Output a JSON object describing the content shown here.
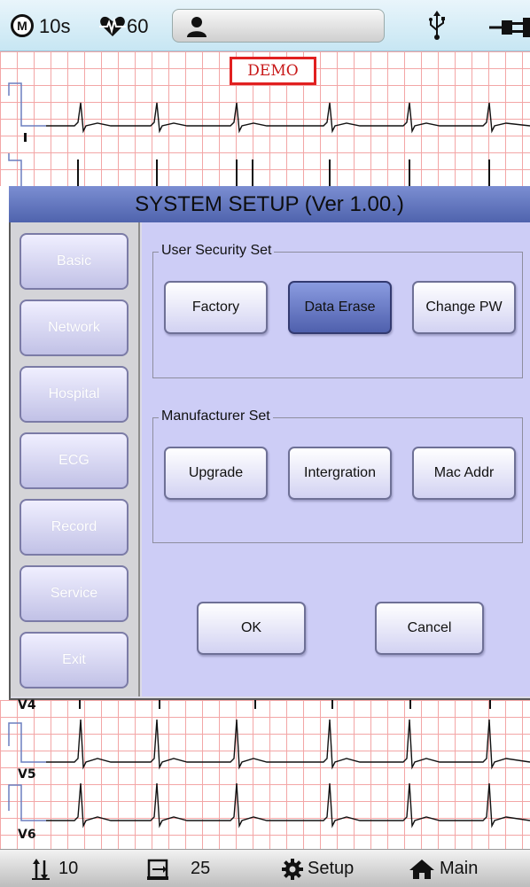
{
  "status": {
    "mode_letter": "M",
    "duration": "10s",
    "heart_rate": "60"
  },
  "demo_label": "DEMO",
  "leads_bottom": [
    "V4",
    "V5",
    "V6"
  ],
  "dialog": {
    "title": "SYSTEM SETUP (Ver 1.00.)",
    "sidebar": [
      "Basic",
      "Network",
      "Hospital",
      "ECG",
      "Record",
      "Service",
      "Exit"
    ],
    "user_security": {
      "title": "User Security Set",
      "buttons": [
        "Factory",
        "Data Erase",
        "Change PW"
      ],
      "selected": "Data Erase"
    },
    "manufacturer": {
      "title": "Manufacturer Set",
      "buttons": [
        "Upgrade",
        "Intergration",
        "Mac Addr"
      ]
    },
    "ok_label": "OK",
    "cancel_label": "Cancel"
  },
  "toolbar": {
    "speed": "10",
    "gain": "25",
    "setup_label": "Setup",
    "main_label": "Main"
  },
  "colors": {
    "title_bar": "#5f73bd",
    "selected_button": "#5a6bb5",
    "panel": "#cdcdf6",
    "grid": "#f3a6a6",
    "demo_border": "#e12020"
  }
}
